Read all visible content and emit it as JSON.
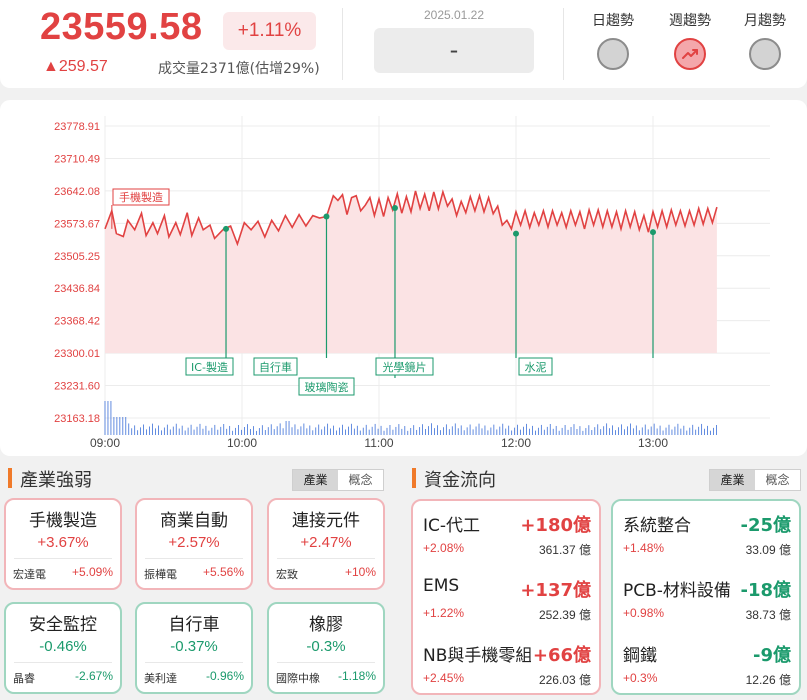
{
  "index": {
    "price": "23559.58",
    "change_pct": "+1.11%",
    "change": "▲259.57",
    "volume": "成交量2371億(估增29%)"
  },
  "date": {
    "label": "2025.01.22",
    "value": "-"
  },
  "trends": [
    {
      "label": "日趨勢",
      "state": "neutral"
    },
    {
      "label": "週趨勢",
      "state": "up"
    },
    {
      "label": "月趨勢",
      "state": "neutral"
    }
  ],
  "chart_data": {
    "type": "line",
    "y_ticks": [
      "23778.91",
      "23710.49",
      "23642.08",
      "23573.67",
      "23505.25",
      "23436.84",
      "23368.42",
      "23300.01",
      "23231.60",
      "23163.18"
    ],
    "x_ticks": [
      "09:00",
      "10:00",
      "11:00",
      "12:00",
      "13:00"
    ],
    "ylim": [
      23163.18,
      23778.91
    ],
    "price_ylim": [
      23300.01,
      23778.91
    ],
    "x_range_minutes": [
      0,
      270
    ],
    "series": [
      {
        "color": "#e14242",
        "points": [
          [
            0,
            23562
          ],
          [
            3,
            23600
          ],
          [
            5,
            23552
          ],
          [
            8,
            23546
          ],
          [
            10,
            23580
          ],
          [
            13,
            23560
          ],
          [
            16,
            23595
          ],
          [
            18,
            23548
          ],
          [
            21,
            23575
          ],
          [
            23,
            23552
          ],
          [
            26,
            23590
          ],
          [
            28,
            23545
          ],
          [
            31,
            23575
          ],
          [
            33,
            23550
          ],
          [
            36,
            23596
          ],
          [
            38,
            23548
          ],
          [
            41,
            23585
          ],
          [
            43,
            23560
          ],
          [
            46,
            23570
          ],
          [
            48,
            23542
          ],
          [
            52,
            23562
          ],
          [
            55,
            23568
          ],
          [
            58,
            23530
          ],
          [
            61,
            23575
          ],
          [
            64,
            23560
          ],
          [
            67,
            23578
          ],
          [
            70,
            23545
          ],
          [
            73,
            23580
          ],
          [
            76,
            23558
          ],
          [
            79,
            23590
          ],
          [
            82,
            23565
          ],
          [
            85,
            23592
          ],
          [
            88,
            23568
          ],
          [
            91,
            23590
          ],
          [
            94,
            23585
          ],
          [
            97,
            23588
          ],
          [
            100,
            23632
          ],
          [
            102,
            23622
          ],
          [
            104,
            23634
          ],
          [
            106,
            23592
          ],
          [
            108,
            23628
          ],
          [
            110,
            23632
          ],
          [
            112,
            23600
          ],
          [
            114,
            23612
          ],
          [
            116,
            23628
          ],
          [
            118,
            23590
          ],
          [
            120,
            23625
          ],
          [
            122,
            23588
          ],
          [
            124,
            23628
          ],
          [
            126,
            23602
          ],
          [
            128,
            23636
          ],
          [
            130,
            23595
          ],
          [
            132,
            23630
          ],
          [
            134,
            23598
          ],
          [
            136,
            23642
          ],
          [
            138,
            23605
          ],
          [
            140,
            23635
          ],
          [
            142,
            23600
          ],
          [
            144,
            23640
          ],
          [
            146,
            23604
          ],
          [
            148,
            23640
          ],
          [
            150,
            23610
          ],
          [
            152,
            23625
          ],
          [
            154,
            23590
          ],
          [
            156,
            23620
          ],
          [
            158,
            23596
          ],
          [
            160,
            23630
          ],
          [
            162,
            23600
          ],
          [
            164,
            23632
          ],
          [
            166,
            23598
          ],
          [
            168,
            23628
          ],
          [
            170,
            23594
          ],
          [
            172,
            23610
          ],
          [
            174,
            23570
          ],
          [
            176,
            23580
          ],
          [
            178,
            23562
          ],
          [
            180,
            23598
          ],
          [
            182,
            23570
          ],
          [
            184,
            23600
          ],
          [
            186,
            23565
          ],
          [
            188,
            23596
          ],
          [
            190,
            23570
          ],
          [
            192,
            23600
          ],
          [
            194,
            23566
          ],
          [
            196,
            23600
          ],
          [
            198,
            23570
          ],
          [
            200,
            23596
          ],
          [
            202,
            23565
          ],
          [
            204,
            23600
          ],
          [
            206,
            23570
          ],
          [
            208,
            23598
          ],
          [
            210,
            23562
          ],
          [
            212,
            23602
          ],
          [
            214,
            23570
          ],
          [
            216,
            23602
          ],
          [
            218,
            23566
          ],
          [
            220,
            23600
          ],
          [
            222,
            23566
          ],
          [
            224,
            23598
          ],
          [
            226,
            23562
          ],
          [
            228,
            23600
          ],
          [
            230,
            23566
          ],
          [
            232,
            23598
          ],
          [
            234,
            23560
          ],
          [
            236,
            23590
          ],
          [
            238,
            23555
          ],
          [
            240,
            23598
          ],
          [
            242,
            23566
          ],
          [
            244,
            23600
          ],
          [
            246,
            23566
          ],
          [
            248,
            23602
          ],
          [
            250,
            23570
          ],
          [
            252,
            23600
          ],
          [
            254,
            23568
          ],
          [
            256,
            23600
          ],
          [
            258,
            23570
          ],
          [
            260,
            23605
          ],
          [
            262,
            23572
          ],
          [
            264,
            23605
          ],
          [
            266,
            23575
          ],
          [
            268,
            23608
          ]
        ]
      }
    ],
    "volume_bars_note": "intraday volume shown as thin blue bars at bottom",
    "annotations": [
      {
        "label": "手機製造",
        "x": 3,
        "y": 23562,
        "type": "up"
      },
      {
        "label": "IC-製造",
        "x": 53,
        "y": 23562,
        "type": "down"
      },
      {
        "label": "自行車",
        "x": 97,
        "y": 23588,
        "type": "down"
      },
      {
        "label": "玻璃陶瓷",
        "x": 127,
        "y": 23606,
        "type": "down"
      },
      {
        "label": "光學鏡片",
        "x": 180,
        "y": 23552,
        "type": "down"
      },
      {
        "label": "水泥",
        "x": 240,
        "y": 23555,
        "type": "down"
      }
    ]
  },
  "industry": {
    "title": "產業強弱",
    "tabs": [
      "產業",
      "概念"
    ],
    "cards": [
      {
        "name": "手機製造",
        "pct": "+3.67%",
        "stock": "宏達電",
        "stock_pct": "+5.09%",
        "dir": "up"
      },
      {
        "name": "商業自動",
        "pct": "+2.57%",
        "stock": "振樺電",
        "stock_pct": "+5.56%",
        "dir": "up"
      },
      {
        "name": "連接元件",
        "pct": "+2.47%",
        "stock": "宏致",
        "stock_pct": "+10%",
        "dir": "up"
      },
      {
        "name": "安全監控",
        "pct": "-0.46%",
        "stock": "晶睿",
        "stock_pct": "-2.67%",
        "dir": "down"
      },
      {
        "name": "自行車",
        "pct": "-0.37%",
        "stock": "美利達",
        "stock_pct": "-0.96%",
        "dir": "down"
      },
      {
        "name": "橡膠",
        "pct": "-0.3%",
        "stock": "國際中橡",
        "stock_pct": "-1.18%",
        "dir": "down"
      }
    ]
  },
  "flow": {
    "title": "資金流向",
    "tabs": [
      "產業",
      "概念"
    ],
    "inflow": [
      {
        "name": "IC-代工",
        "amount": "+180億",
        "pct": "+2.08%",
        "volume": "361.37 億"
      },
      {
        "name": "EMS",
        "amount": "+137億",
        "pct": "+1.22%",
        "volume": "252.39 億"
      },
      {
        "name": "NB與手機零組件",
        "amount": "+66億",
        "pct": "+2.45%",
        "volume": "226.03 億"
      }
    ],
    "outflow": [
      {
        "name": "系統整合",
        "amount": "-25億",
        "pct": "+1.48%",
        "volume": "33.09 億"
      },
      {
        "name": "PCB-材料設備",
        "amount": "-18億",
        "pct": "+0.98%",
        "volume": "38.73 億"
      },
      {
        "name": "鋼鐵",
        "amount": "-9億",
        "pct": "+0.3%",
        "volume": "12.26 億"
      }
    ]
  }
}
